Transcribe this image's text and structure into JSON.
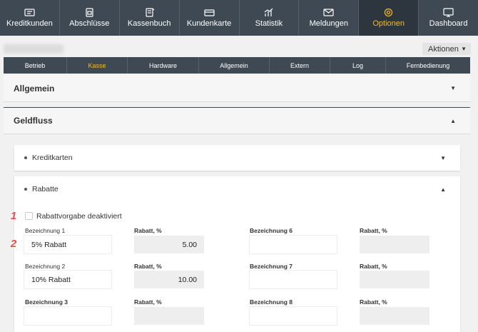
{
  "nav": {
    "items": [
      {
        "label": "Kreditkunden",
        "icon": "id-card-icon"
      },
      {
        "label": "Abschlüsse",
        "icon": "report-icon"
      },
      {
        "label": "Kassenbuch",
        "icon": "book-icon"
      },
      {
        "label": "Kundenkarte",
        "icon": "card-icon"
      },
      {
        "label": "Statistik",
        "icon": "chart-icon"
      },
      {
        "label": "Meldungen",
        "icon": "mail-icon"
      },
      {
        "label": "Optionen",
        "icon": "gear-icon"
      },
      {
        "label": "Dashboard",
        "icon": "monitor-icon"
      }
    ],
    "active": "Optionen",
    "active_color": "#f5b82e",
    "bg_color": "#3e4953"
  },
  "header": {
    "actions_label": "Aktionen"
  },
  "subtabs": {
    "items": [
      "Betrieb",
      "Kasse",
      "Hardware",
      "Allgemein",
      "Extern",
      "Log",
      "Fernbedienung"
    ],
    "active": "Kasse"
  },
  "sections": {
    "allgemein": "Allgemein",
    "geldfluss": "Geldfluss"
  },
  "cards": {
    "kreditkarten": "Kreditkarten",
    "rabatte": "Rabatte"
  },
  "rabatte": {
    "checkbox_label": "Rabattvorgabe deaktiviert",
    "checkbox_checked": false,
    "rows": [
      {
        "l_label": "Bezeichnung 1",
        "l_value": "5% Rabatt",
        "l_rabatt_label": "Rabatt, %",
        "l_rabatt": "5.00",
        "r_label": "Bezeichnung 6",
        "r_value": "",
        "r_rabatt_label": "Rabatt, %",
        "r_rabatt": ""
      },
      {
        "l_label": "Bezeichnung 2",
        "l_value": "10% Rabatt",
        "l_rabatt_label": "Rabatt, %",
        "l_rabatt": "10.00",
        "r_label": "Bezeichnung 7",
        "r_value": "",
        "r_rabatt_label": "Rabatt, %",
        "r_rabatt": ""
      },
      {
        "l_label": "Bezeichnung 3",
        "l_value": "",
        "l_rabatt_label": "Rabatt, %",
        "l_rabatt": "",
        "r_label": "Bezeichnung 8",
        "r_value": "",
        "r_rabatt_label": "Rabatt, %",
        "r_rabatt": ""
      }
    ]
  },
  "annotations": {
    "badge_1": "1",
    "badge_2": "2",
    "color": "#e94b4b"
  }
}
